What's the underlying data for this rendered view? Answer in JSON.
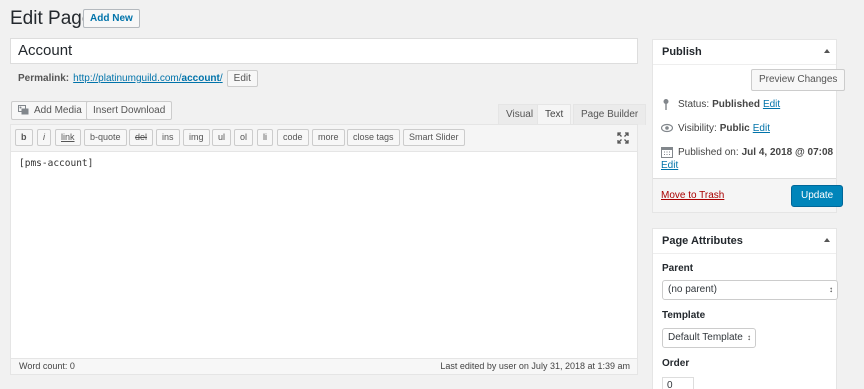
{
  "header": {
    "title": "Edit Page",
    "add_new": "Add New"
  },
  "post": {
    "title": "Account",
    "permalink_label": "Permalink:",
    "permalink_base": "http://platinumguild.com/",
    "permalink_slug": "account",
    "permalink_end": "/",
    "permalink_edit": "Edit"
  },
  "media": {
    "add_media": "Add Media",
    "insert_download": "Insert Download"
  },
  "editor_tabs": {
    "visual": "Visual",
    "text": "Text",
    "page_builder": "Page Builder"
  },
  "quicktags": [
    "b",
    "i",
    "link",
    "b-quote",
    "del",
    "ins",
    "img",
    "ul",
    "ol",
    "li",
    "code",
    "more",
    "close tags",
    "Smart Slider"
  ],
  "content": "[pms-account]",
  "footer": {
    "word_count": "Word count: 0",
    "last_edited": "Last edited by user on July 31, 2018 at 1:39 am"
  },
  "publish": {
    "title": "Publish",
    "preview": "Preview Changes",
    "status_label": "Status:",
    "status_value": "Published",
    "visibility_label": "Visibility:",
    "visibility_value": "Public",
    "published_label": "Published on:",
    "published_value": "Jul 4, 2018 @ 07:08",
    "edit": "Edit",
    "move_to_trash": "Move to Trash",
    "update": "Update"
  },
  "attributes": {
    "title": "Page Attributes",
    "parent_label": "Parent",
    "parent_value": "(no parent)",
    "template_label": "Template",
    "template_value": "Default Template",
    "order_label": "Order",
    "order_value": "0"
  },
  "colors": {
    "link": "#0073aa",
    "primary_button": "#0085ba",
    "trash": "#a00",
    "background": "#f1f1f1"
  }
}
